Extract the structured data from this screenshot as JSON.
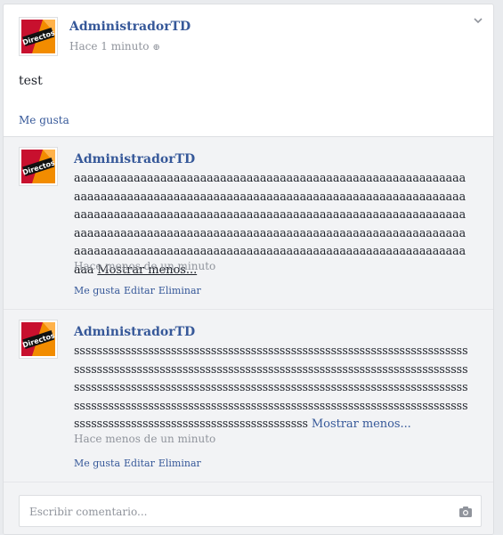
{
  "post": {
    "author": "AdministradorTD",
    "time": "Hace 1 minuto",
    "privacy_icon": "globe-icon",
    "body": "test",
    "like_label": "Me gusta",
    "menu_icon": "chevron-down-icon"
  },
  "comments": [
    {
      "author": "AdministradorTD",
      "text": "aaaaaaaaaaaaaaaaaaaaaaaaaaaaaaaaaaaaaaaaaaaaaaaaaaaaaaaaaaaaaaaaaaaaaaaaaaaaaaaaaaaaaaaaaaaaaaaaaaaaaaaaaaaaaaaaaaaaaaaaaaaaaaaaaaaaaaaaaaaaaaaaaaaaaaaaaaaaaaaaaaaaaaaaaaaaaaaaaaaaaaaaaaaaaaaaaaaaaaaaaaaaaaaaaaaaaaaaaaaaaaaaaaaaaaaaaaaaaaaaaaaaaaaaaaaaaaaaaaaaaaaaaaaaaaaaaaaaaaaaaaaaaaaaaaaaaaaaaa",
      "toggle": "Mostrar menos...",
      "time": "Hace menos de un minuto",
      "actions": [
        "Me gusta",
        "Editar",
        "Eliminar"
      ]
    },
    {
      "author": "AdministradorTD",
      "text": "sssssssssssssssssssssssssssssssssssssssssssssssssssssssssssssssssssssssssssssssssssssssssssssssssssssssssssssssssssssssssssssssssssssssssssssssssssssssssssssssssssssssssssssssssssssssssssssssssssssssssssssssssssssssssssssssssssssssssssssssssssssssssssssssssssssssssssssssssssssssssssssssssssssssssssssssssssssssssssss",
      "toggle": "Mostrar menos...",
      "time": "Hace menos de un minuto",
      "actions": [
        "Me gusta",
        "Editar",
        "Eliminar"
      ]
    }
  ],
  "composer": {
    "placeholder": "Escribir comentario...",
    "camera_icon": "camera-icon"
  },
  "avatar": {
    "logo_text": "Directos"
  },
  "colors": {
    "link": "#365899",
    "muted": "#90949c",
    "comments_bg": "#f2f3f5",
    "logo_red": "#c8102e",
    "logo_orange": "#f28c00"
  }
}
